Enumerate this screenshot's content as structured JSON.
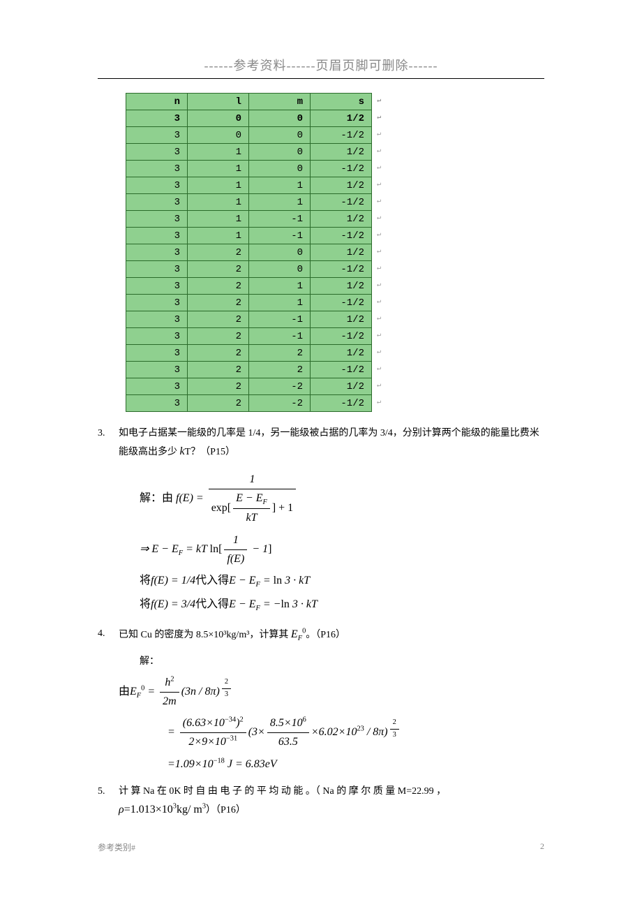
{
  "header": {
    "note": "------参考资料------页眉页脚可删除------"
  },
  "table": {
    "headers": [
      "n",
      "l",
      "m",
      "s"
    ],
    "rows": [
      [
        "3",
        "0",
        "0",
        "1/2"
      ],
      [
        "3",
        "0",
        "0",
        "-1/2"
      ],
      [
        "3",
        "1",
        "0",
        "1/2"
      ],
      [
        "3",
        "1",
        "0",
        "-1/2"
      ],
      [
        "3",
        "1",
        "1",
        "1/2"
      ],
      [
        "3",
        "1",
        "1",
        "-1/2"
      ],
      [
        "3",
        "1",
        "-1",
        "1/2"
      ],
      [
        "3",
        "1",
        "-1",
        "-1/2"
      ],
      [
        "3",
        "2",
        "0",
        "1/2"
      ],
      [
        "3",
        "2",
        "0",
        "-1/2"
      ],
      [
        "3",
        "2",
        "1",
        "1/2"
      ],
      [
        "3",
        "2",
        "1",
        "-1/2"
      ],
      [
        "3",
        "2",
        "-1",
        "1/2"
      ],
      [
        "3",
        "2",
        "-1",
        "-1/2"
      ],
      [
        "3",
        "2",
        "2",
        "1/2"
      ],
      [
        "3",
        "2",
        "2",
        "-1/2"
      ],
      [
        "3",
        "2",
        "-2",
        "1/2"
      ],
      [
        "3",
        "2",
        "-2",
        "-1/2"
      ]
    ]
  },
  "problems": {
    "p3": {
      "num": "3.",
      "text_a": "如电子占据某一能级的几率是 1/4，另一能级被占据的几率为 3/4，分别计算两个能级的能量比费米能级高出多少 ",
      "text_b": "T？（P15）",
      "sol_label": "解：由",
      "line2_prefix": "⇒ ",
      "line3": "将f(E) = 1/4代入得E − E_F = ln 3 · kT",
      "line4": "将f(E) = 3/4代入得E − E_F = − ln 3 · kT"
    },
    "p4": {
      "num": "4.",
      "text_a": "已知 Cu 的密度为 8.5×10³kg/m³，计算其 ",
      "text_b": "。（P16）",
      "sol_label": "解：",
      "line1_prefix": "由",
      "result": "=1.09×10⁻¹⁸ J = 6.83eV"
    },
    "p5": {
      "num": "5.",
      "text_a": "计 算 Na 在 0K 时 自 由 电 子 的 平 均 动 能 。（ Na 的 摩 尔 质 量 M=22.99 ，",
      "density": "ρ=1.013×10³kg/m³",
      "ref": "）（P16）"
    }
  },
  "footer": {
    "left": "参考类别#",
    "right": "2"
  }
}
